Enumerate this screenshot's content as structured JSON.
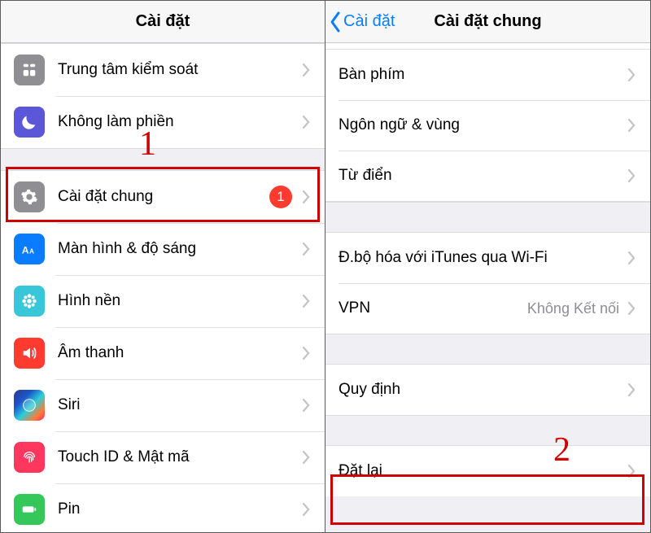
{
  "left": {
    "title": "Cài đặt",
    "annotation": "1",
    "rows": {
      "control_center": "Trung tâm kiểm soát",
      "dnd": "Không làm phiền",
      "general": "Cài đặt chung",
      "general_badge": "1",
      "display": "Màn hình & độ sáng",
      "wallpaper": "Hình nền",
      "sounds": "Âm thanh",
      "siri": "Siri",
      "touchid": "Touch ID & Mật mã",
      "battery": "Pin"
    }
  },
  "right": {
    "back": "Cài đặt",
    "title": "Cài đặt chung",
    "annotation": "2",
    "rows": {
      "keyboard": "Bàn phím",
      "language": "Ngôn ngữ & vùng",
      "dictionary": "Từ điển",
      "itunes_wifi": "Đ.bộ hóa với iTunes qua Wi-Fi",
      "vpn": "VPN",
      "vpn_value": "Không Kết nối",
      "regulatory": "Quy định",
      "reset": "Đặt lại"
    }
  }
}
